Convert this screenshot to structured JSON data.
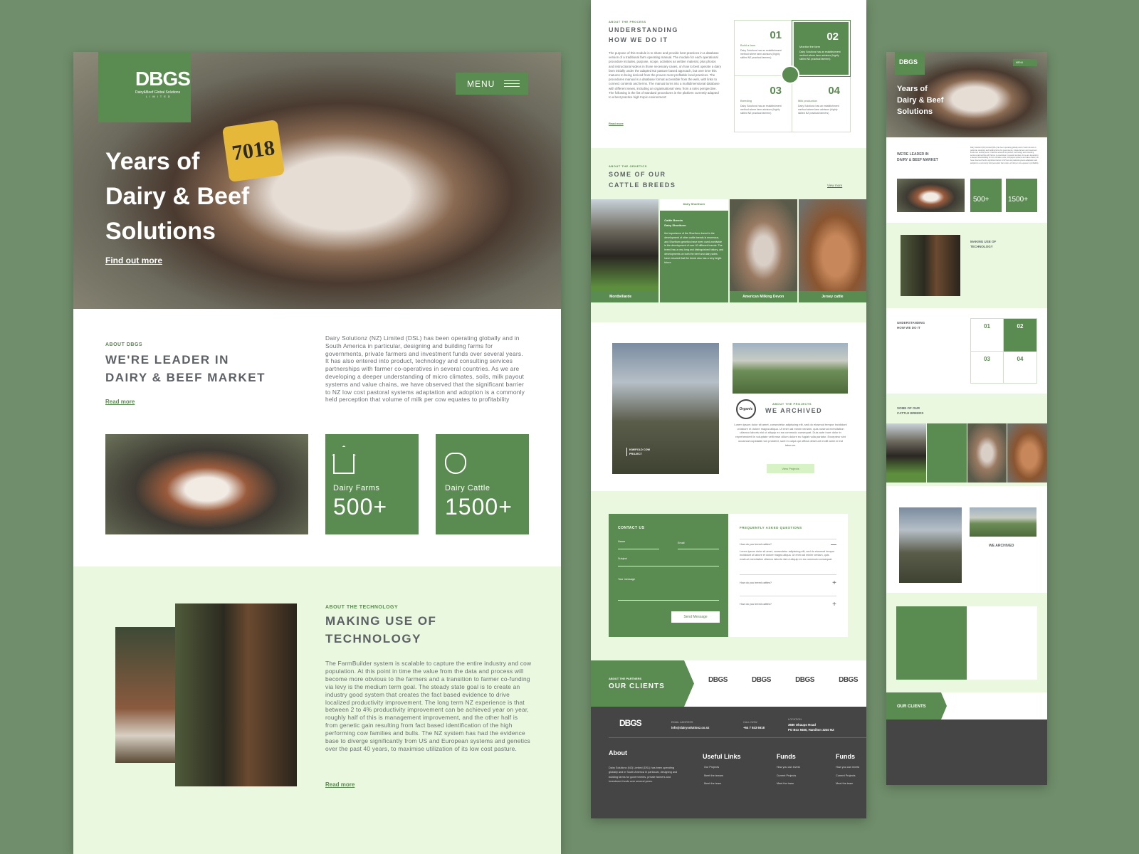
{
  "colors": {
    "brand_green": "#5a8b50",
    "light_green": "#eaf8df",
    "footer": "#454545",
    "background": "#708e6b"
  },
  "logo": {
    "text": "DBGS",
    "tagline": "Dairy&Beef Global Solutions",
    "sub": "LIMITED"
  },
  "hero": {
    "menu": "MENU",
    "title_lines": [
      "Years of",
      "Dairy & Beef",
      "Solutions"
    ],
    "cta": "Find out more"
  },
  "about": {
    "label": "ABOUT DBGS",
    "heading_lines": [
      "WE'RE LEADER IN",
      "DAIRY & BEEF MARKET"
    ],
    "read_more": "Read more",
    "body": "Dairy Solutionz (NZ) Limited (DSL) has been operating globally and in South America in particular, designing and building farms for governments, private farmers and investment funds over several years.  It has also entered into product, technology and consulting services partnerships with farmer co-operatives in several countries.  As we are developing a deeper understanding of micro climates, soils, milk payout systems and value chains, we have observed that the significant barrier to NZ low cost pastoral systems adaptation and adoption is a commonly held perception that volume of milk per cow equates to profitability"
  },
  "stats": [
    {
      "icon": "barn-icon",
      "label": "Dairy Farms",
      "value": "500+"
    },
    {
      "icon": "cow-head-icon",
      "label": "Dairy Cattle",
      "value": "1500+"
    }
  ],
  "technology": {
    "label": "ABOUT THE TECHNOLOGY",
    "heading_lines": [
      "MAKING USE OF",
      "TECHNOLOGY"
    ],
    "read_more": "Read more",
    "body": "The FarmBuilder system is scalable to capture the entire industry and cow population.  At this point in time the value from the data and process will become more obvious to the farmers and a transition to farmer co-funding via levy is the medium term goal.  The steady state goal is to create an industry good system that creates the fact based evidence to drive localized productivity improvement.  The long term NZ experience is that between 2 to 4% productivity improvement can be achieved year on year, roughly half of this is management improvement, and the other half is from genetic gain resulting from fact based identification of the high performing cow families and bulls.  The NZ system has had the evidence base to diverge significantly from US and European systems and genetics over the past 40 years, to maximise utilization of its low cost pasture."
  },
  "process": {
    "label": "ABOUT THE PROCESS",
    "heading_lines": [
      "UNDERSTANDING",
      "HOW WE DO IT"
    ],
    "read_more": "Read more",
    "body": "The purpose of this module is to share and provide best practices in a database version of a traditional  farm operating manual.  The module for each operational procedure includes, purpose, scope, activities as written material, plus photos and instructional videos in those necessary cases, on how to best operate a dairy farm initially under the adapted NZ pasture based approach, but over time this matures to being derived from the proven most profitable local practices. The procedures manual is a database format accessible from the web, with links to connect contents and terms.  The manual turns into a multidimensional database with different views, including an organisational view, from a roles perspective. The following is the list of standard procedures in the platform currently adapted to a best practice high tropic environment:",
    "steps": [
      {
        "num": "01",
        "title": "Build a farm",
        "text": "Dairy Solutionz has an establishment method where farm advisors (highly skilled NZ practical farmers)"
      },
      {
        "num": "02",
        "title": "Monitor the farm",
        "text": "Dairy Solutionz has an establishment method where farm advisors (highly skilled NZ practical farmers)"
      },
      {
        "num": "03",
        "title": "Breeding",
        "text": "Dairy Solutionz has an establishment method where farm advisors (highly skilled NZ practical farmers)"
      },
      {
        "num": "04",
        "title": "Milk production",
        "text": "Dairy Solutionz has an establishment method where farm advisors (highly skilled NZ practical farmers)"
      }
    ]
  },
  "breeds": {
    "label": "ABOUT THE GENETICS",
    "heading_lines": [
      "SOME OF OUR",
      "CATTLE BREEDS"
    ],
    "view_more": "View more",
    "items": [
      "Montbéliarde",
      "Dairy Shorthorn",
      "American Milking Devon",
      "Jersey cattle"
    ],
    "featured": {
      "tab": "Dairy Shorthorn",
      "title_lines": [
        "Cattle Breeds",
        "Dairy Shorthorn"
      ],
      "text": "the importance of the Shorthorn breed in the development of other cattle breeds is enormous, and Shorthorn genetics have been used worldwide in the development of over 40 different breeds. The breed has a very long and distinguished history, and developments on both the beef and dairy sides have ensured that the breed also has a very bright future."
    }
  },
  "projects": {
    "label": "ABOUT THE PROJECTS",
    "heading": "WE ARCHIVED",
    "badge": "Organic",
    "photo_caption_lines": [
      "KIWIFOLD COW",
      "PROJECT"
    ],
    "button": "View Projects",
    "body": "Lorem ipsum dolor sit amet, consectetur adipiscing elit, sed do eiusmod tempor incididunt ut labore et dolore magna aliqua. Ut enim ad minim veniam, quis nostrud exercitation ullamco laboris nisi ut aliquip ex ea commodo consequat. Duis aute irure dolor in reprehenderit in voluptate velit esse cillum dolore eu fugiat nulla pariatur. Excepteur sint occaecat cupidatat non proident, sunt in culpa qui officia deserunt mollit anim id est laborum."
  },
  "contact": {
    "title": "CONTACT US",
    "name": "Name",
    "email": "Email",
    "subject": "Subject",
    "message": "Your message",
    "send": "Send Message"
  },
  "faq": {
    "title": "FREQUENTLY ASKED QUESTIONS",
    "items": [
      {
        "q": "How do you breed cattles?",
        "a": "Lorem ipsum dolor sit amet, consectetur adipiscing elit, sed do eiusmod tempor incididunt ut labore et dolore magna aliqua. Ut enim ad minim veniam, quis nostrud exercitation ullamco laboris nisi ut aliquip ex ea commodo consequat.",
        "open": true
      },
      {
        "q": "How do you breed cattles?",
        "open": false
      },
      {
        "q": "How do you breed cattles?",
        "open": false
      }
    ]
  },
  "clients": {
    "label": "ABOUT THE PARTNERS",
    "title": "OUR CLIENTS",
    "logos": [
      "DBGS",
      "DBGS",
      "DBGS",
      "DBGS"
    ]
  },
  "footer": {
    "email_label": "EMAIL ADDRESS",
    "email": "info@dairysolutionz.co.nz",
    "call_label": "CALL NOW",
    "phone": "+64 7 843 6618",
    "location_label": "LOCATION",
    "address_lines": [
      "3680 Ohaupo Road",
      "PO Box 9460, Hamilton 3240 NZ"
    ],
    "about_title": "About",
    "about_text": "Dairy Solutionz (NZ) Limited (DSL) has been operating globally and in South America in particular, designing and building farms for governments, private farmers and investment funds over several years.",
    "columns": [
      {
        "title": "Useful Links",
        "links": [
          "Our Projects",
          "Meet the tewam",
          "Meet the team"
        ]
      },
      {
        "title": "Funds",
        "links": [
          "How you can invest",
          "Current Projects",
          "Meet the team"
        ]
      },
      {
        "title": "Funds",
        "links": [
          "How you can invest",
          "Current Projects",
          "Meet the team"
        ]
      }
    ]
  }
}
